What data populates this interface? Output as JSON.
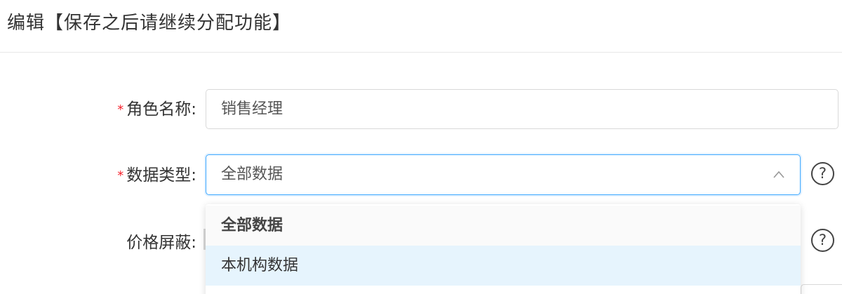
{
  "header": {
    "title": "编辑【保存之后请继续分配功能】"
  },
  "form": {
    "required_mark": "*",
    "role_name": {
      "label": "角色名称:",
      "value": "销售经理"
    },
    "data_type": {
      "label": "数据类型:",
      "value": "全部数据",
      "options": [
        "全部数据",
        "本机构数据"
      ],
      "help": "?"
    },
    "price_mask": {
      "label": "价格屏蔽:",
      "help": "?"
    }
  },
  "colors": {
    "accent": "#40a9ff",
    "required": "#f5222d",
    "hover": "#e6f4fd"
  },
  "icons": {
    "chevron": "chevron-up-icon",
    "help": "question-circle-icon"
  }
}
